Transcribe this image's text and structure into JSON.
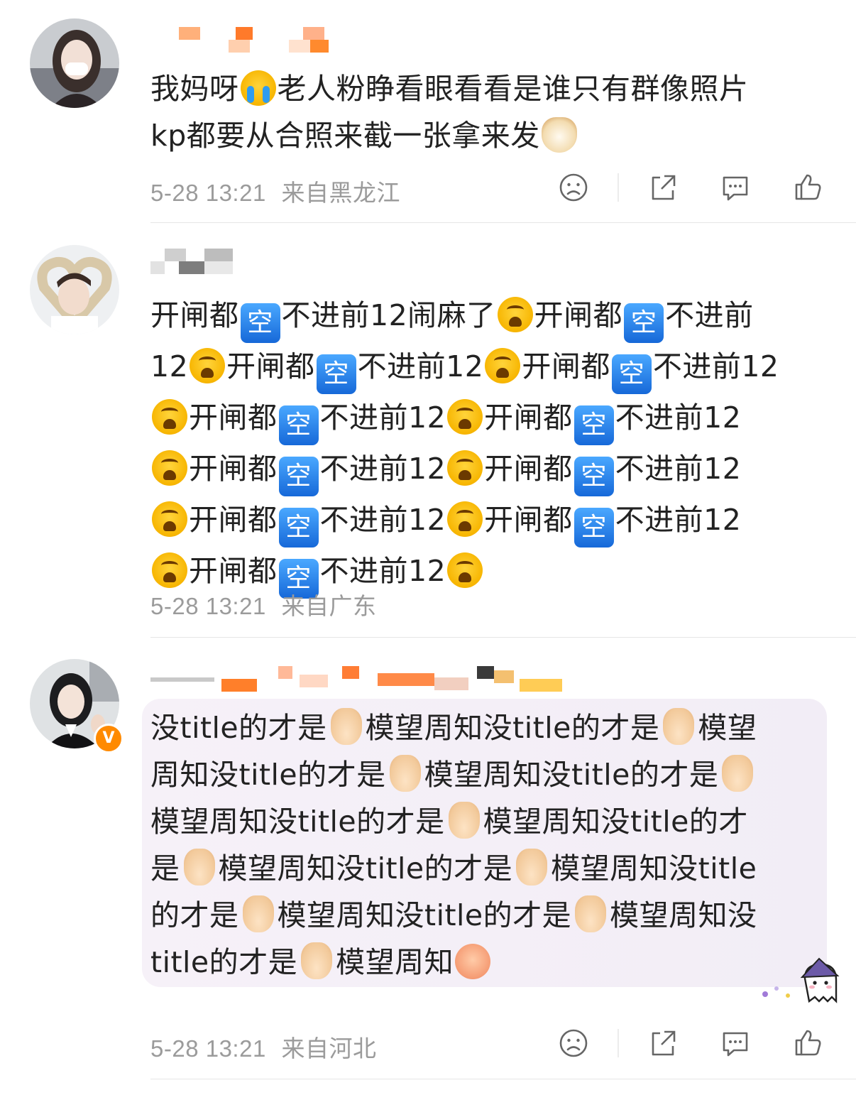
{
  "comments": [
    {
      "text_line1_a": "我妈呀",
      "text_line1_b": "老人粉睁看眼看看是谁只有群像照片",
      "text_line2": "kp都要从合照来截一张拿来发",
      "timestamp": "5-28 13:21",
      "location": "来自黑龙江",
      "show_actions": true
    },
    {
      "segment_a": "开闸都",
      "key_char": "空",
      "segment_b": "不进前12",
      "segment_c": "闹麻了",
      "timestamp": "5-28 13:21",
      "location": "来自广东",
      "show_actions": false
    },
    {
      "verified_badge": "V",
      "seg_1": "没title的才是",
      "seg_2": "模望周知没title的才是",
      "seg_3": "模望",
      "seg_4": "周知没title的才是",
      "seg_5": "模望周知没title的才是",
      "seg_6": "模望周知没title的才",
      "seg_7": "是",
      "seg_8": "模望周知没title的才是",
      "seg_9": "模望周知没title",
      "seg_10": "的才是",
      "seg_11": "模望周知没title的才是",
      "seg_12": "模望周知没",
      "seg_13": "title的才是",
      "seg_14": "模望周知",
      "timestamp": "5-28 13:21",
      "location": "来自河北",
      "show_actions": true
    }
  ],
  "icons": {
    "dislike": "sad-face-icon",
    "share": "share-icon",
    "comment": "comment-icon",
    "like": "thumbs-up-icon"
  },
  "colors": {
    "meta_text": "#9b9b9b",
    "badge": "#ff8a00",
    "bubble": "#f4eff7"
  }
}
